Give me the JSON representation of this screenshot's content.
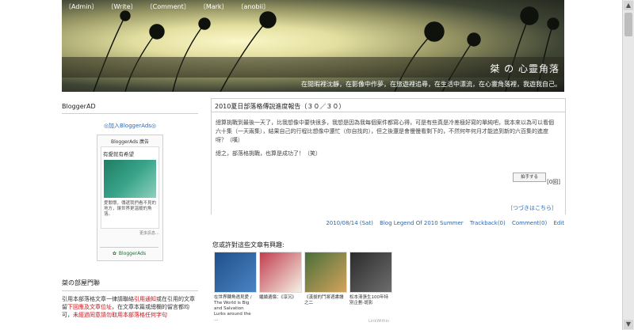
{
  "nav": [
    "〔Admin〕",
    "〔Write〕",
    "〔Comment〕",
    "〔Mark〕",
    "〔anobii〕"
  ],
  "header": {
    "site_title": "桀 の 心靈角落",
    "tagline": "在閒暇裡沈靜，在影像中作夢，在旅遊裡追尋，在生活中漂流，在心靈角落裡，我遊我自己。"
  },
  "sidebar": {
    "bloggerad_heading": "BloggerAD",
    "add_link": "◎加入BloggerAds◎",
    "ads_title": "BloggerAds 廣告",
    "ads_card_title": "有愛就有希望",
    "ads_card_text": "愛關懷，傳遞我們看不見的地方，讓世界更溫暖的角落。",
    "ads_more": "更多訊息…",
    "ads_footer_brand": "BloggerAds",
    "jie_rules_heading": "桀の部屋門聯",
    "jie_rules_text_1": "引用本部落格文章一律請聯絡",
    "jie_rules_red_1": "引用通知",
    "jie_rules_text_2": "或在引用的文章留",
    "jie_rules_red_2": "下回應及文章位址",
    "jie_rules_text_3": "，在文章本篇或總欄的留言都均可，",
    "jie_rules_red_3": "未經過同意請勿取用本部落格任何字句"
  },
  "post": {
    "title": "2010夏日部落格傳說進度報告（３０／３０）",
    "body_1": "總算挑戰到最後一天了，比我想像中要快很多，我想是因為我每個案件都寫心得，可是有些真是冷差極好寫的單純吧，我本來以為可以看個六十集（一天兩集），結果自己的行程比想像中還忙（你自找的），但之後還是會慢慢看剩下的，不然何年何月才能追到新的六百集的進度呀？（嘆）",
    "body_2": "總之，部落格挑戰，也算是成功了！（笑）",
    "stamp": "拍手する",
    "count": "[0回]",
    "more_link": "〔つづきはこちら〕",
    "meta_date": "2010/08/14 (Sat)",
    "meta_category": "Blog Legend Of 2010 Summer",
    "meta_trackback": "Trackback(0)",
    "meta_comment": "Comment(0)",
    "meta_edit": "Edit"
  },
  "related": {
    "title": "您或許對這些文章有興趣:",
    "items": [
      {
        "caption": "在世界轉角遇見愛 / The World is Big and Salvation Lurks around the …",
        "color1": "#1f4f8a",
        "color2": "#4a84c4"
      },
      {
        "caption": "繼續遺傷：《淳沉》",
        "color1": "#c13e4f",
        "color2": "#f6f1e4"
      },
      {
        "caption": "《漢拔的鬥將週書讀之二",
        "color1": "#4a6e3a",
        "color2": "#d3a45c"
      },
      {
        "caption": "松本清張生100年特別企劃-斑影",
        "color1": "#2b2b2b",
        "color2": "#6d6d6d"
      }
    ],
    "linkwithin": "LinkWithin"
  }
}
